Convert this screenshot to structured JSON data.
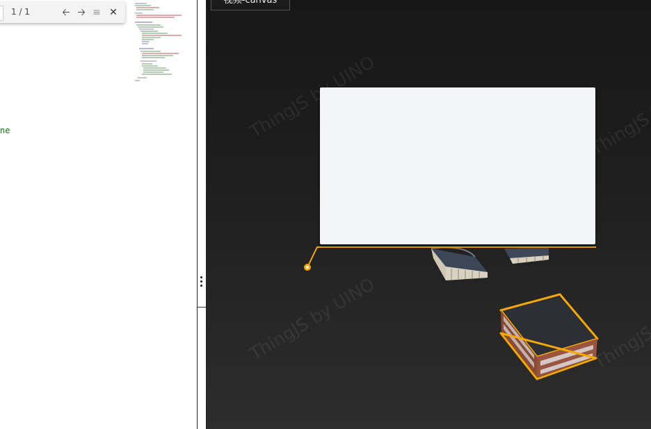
{
  "find": {
    "match_count": "1 / 1",
    "case_icon": "case-sensitive-icon"
  },
  "editor": {
    "code_fragment": "ne"
  },
  "viewport": {
    "sample_tag": "视频-canvas",
    "watermarks": [
      "ThingJS by UINO",
      "ThingJS by UINO",
      "ThingJS by UINO",
      "ThingJS by UINO"
    ]
  },
  "colors": {
    "highlight": "#f5a800",
    "panel": "#f4f5f6"
  }
}
